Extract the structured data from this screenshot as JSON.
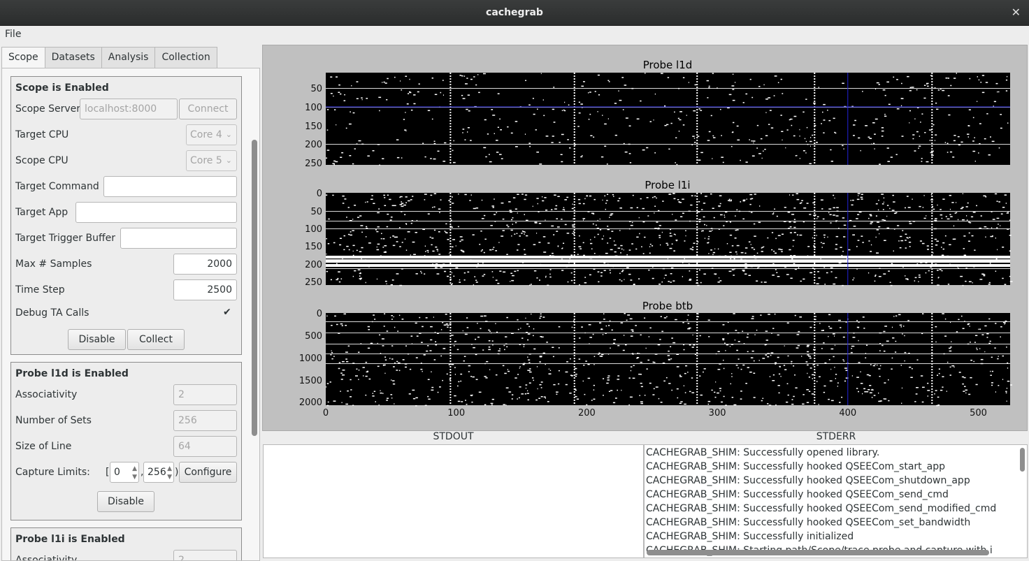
{
  "window": {
    "title": "cachegrab",
    "close_glyph": "✕"
  },
  "menu": {
    "file": "File"
  },
  "tabs": [
    "Scope",
    "Datasets",
    "Analysis",
    "Collection"
  ],
  "scope": {
    "title": "Scope is Enabled",
    "server_label": "Scope Server",
    "server_placeholder": "localhost:8000",
    "connect_label": "Connect",
    "target_cpu_label": "Target CPU",
    "target_cpu_value": "Core 4",
    "scope_cpu_label": "Scope CPU",
    "scope_cpu_value": "Core 5",
    "target_command_label": "Target Command",
    "target_command_value": "",
    "target_app_label": "Target App",
    "target_app_value": "",
    "trigger_buffer_label": "Target Trigger Buffer",
    "trigger_buffer_value": "",
    "max_samples_label": "Max # Samples",
    "max_samples_value": "2000",
    "time_step_label": "Time Step",
    "time_step_value": "2500",
    "debug_label": "Debug TA Calls",
    "debug_checked": "✔",
    "disable_label": "Disable",
    "collect_label": "Collect"
  },
  "probe_l1d": {
    "title": "Probe l1d is Enabled",
    "assoc_label": "Associativity",
    "assoc_value": "2",
    "sets_label": "Number of Sets",
    "sets_value": "256",
    "line_label": "Size of Line",
    "line_value": "64",
    "limits_label": "Capture Limits:",
    "open_bracket": "[",
    "limit_low": "0",
    "comma": ",",
    "limit_high": "256",
    "close_bracket": ")",
    "configure_label": "Configure",
    "disable_label": "Disable"
  },
  "probe_l1i": {
    "title": "Probe l1i is Enabled",
    "assoc_label": "Associativity",
    "assoc_value": "2"
  },
  "plots": [
    {
      "title": "Probe l1d",
      "yticks": [
        "50",
        "100",
        "150",
        "200",
        "250"
      ]
    },
    {
      "title": "Probe l1i",
      "yticks": [
        "0",
        "50",
        "100",
        "150",
        "200",
        "250"
      ]
    },
    {
      "title": "Probe btb",
      "yticks": [
        "0",
        "500",
        "1000",
        "1500",
        "2000"
      ]
    }
  ],
  "xticks": [
    "0",
    "100",
    "200",
    "300",
    "400",
    "500"
  ],
  "stdout_label": "STDOUT",
  "stderr_label": "STDERR",
  "stderr_lines": [
    "CACHEGRAB_SHIM: Successfully opened library.",
    "CACHEGRAB_SHIM: Successfully hooked QSEECom_start_app",
    "CACHEGRAB_SHIM: Successfully hooked QSEECom_shutdown_app",
    "CACHEGRAB_SHIM: Successfully hooked QSEECom_send_cmd",
    "CACHEGRAB_SHIM: Successfully hooked QSEECom_send_modified_cmd",
    "CACHEGRAB_SHIM: Successfully hooked QSEECom_set_bandwidth",
    "CACHEGRAB_SHIM: Successfully initialized",
    "CACHEGRAB_SHIM: Starting path/Scope/trace probe and capture with i"
  ],
  "icons": {
    "checkbox": "check-icon",
    "spin_up": "▲",
    "spin_down": "▼",
    "combo_arrow": "⌄"
  }
}
